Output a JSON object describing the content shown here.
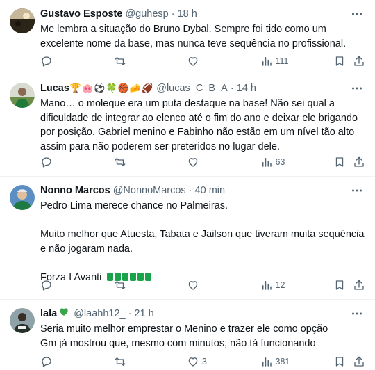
{
  "tweets": [
    {
      "name": "Gustavo Esposte",
      "handle": "@guhesp",
      "time": "18 h",
      "text": "Me lembra a situação do Bruno Dybal. Sempre foi tido como um excelente nome da base, mas nunca teve sequência no profissional.",
      "replies": "",
      "retweets": "",
      "likes": "",
      "views": "111"
    },
    {
      "name": "Lucas",
      "name_emojis": "🏆🐽⚽🍀🏀🧀🏈",
      "handle": "@lucas_C_B_A",
      "time": "14 h",
      "text": "Mano… o moleque era um puta destaque na base! Não sei qual a dificuldade de integrar ao elenco até o fim do ano e deixar ele brigando por posição. Gabriel menino e Fabinho não estão em um nível tão alto assim para não poderem ser preteridos no lugar dele.",
      "replies": "",
      "retweets": "",
      "likes": "",
      "views": "63"
    },
    {
      "name": "Nonno Marcos",
      "handle": "@NonnoMarcos",
      "time": "40 min",
      "text_lines": [
        "Pedro Lima merece chance no Palmeiras.",
        "",
        "Muito melhor que Atuesta, Tabata e Jailson que tiveram muita sequência e não jogaram nada.",
        "",
        "Forza I Avanti"
      ],
      "replies": "",
      "retweets": "",
      "likes": "",
      "views": "12"
    },
    {
      "name": "lala",
      "handle": "@laahh12_",
      "time": "21 h",
      "text": "Seria muito melhor emprestar o Menino e trazer ele como opção\nGm já mostrou que, mesmo com minutos, não tá funcionando",
      "replies": "",
      "retweets": "",
      "likes": "3",
      "views": "381"
    }
  ],
  "dot": "·",
  "colors": {
    "text": "#0f1419",
    "muted": "#536471",
    "border": "#eff3f4",
    "green": "#1aa34a"
  }
}
